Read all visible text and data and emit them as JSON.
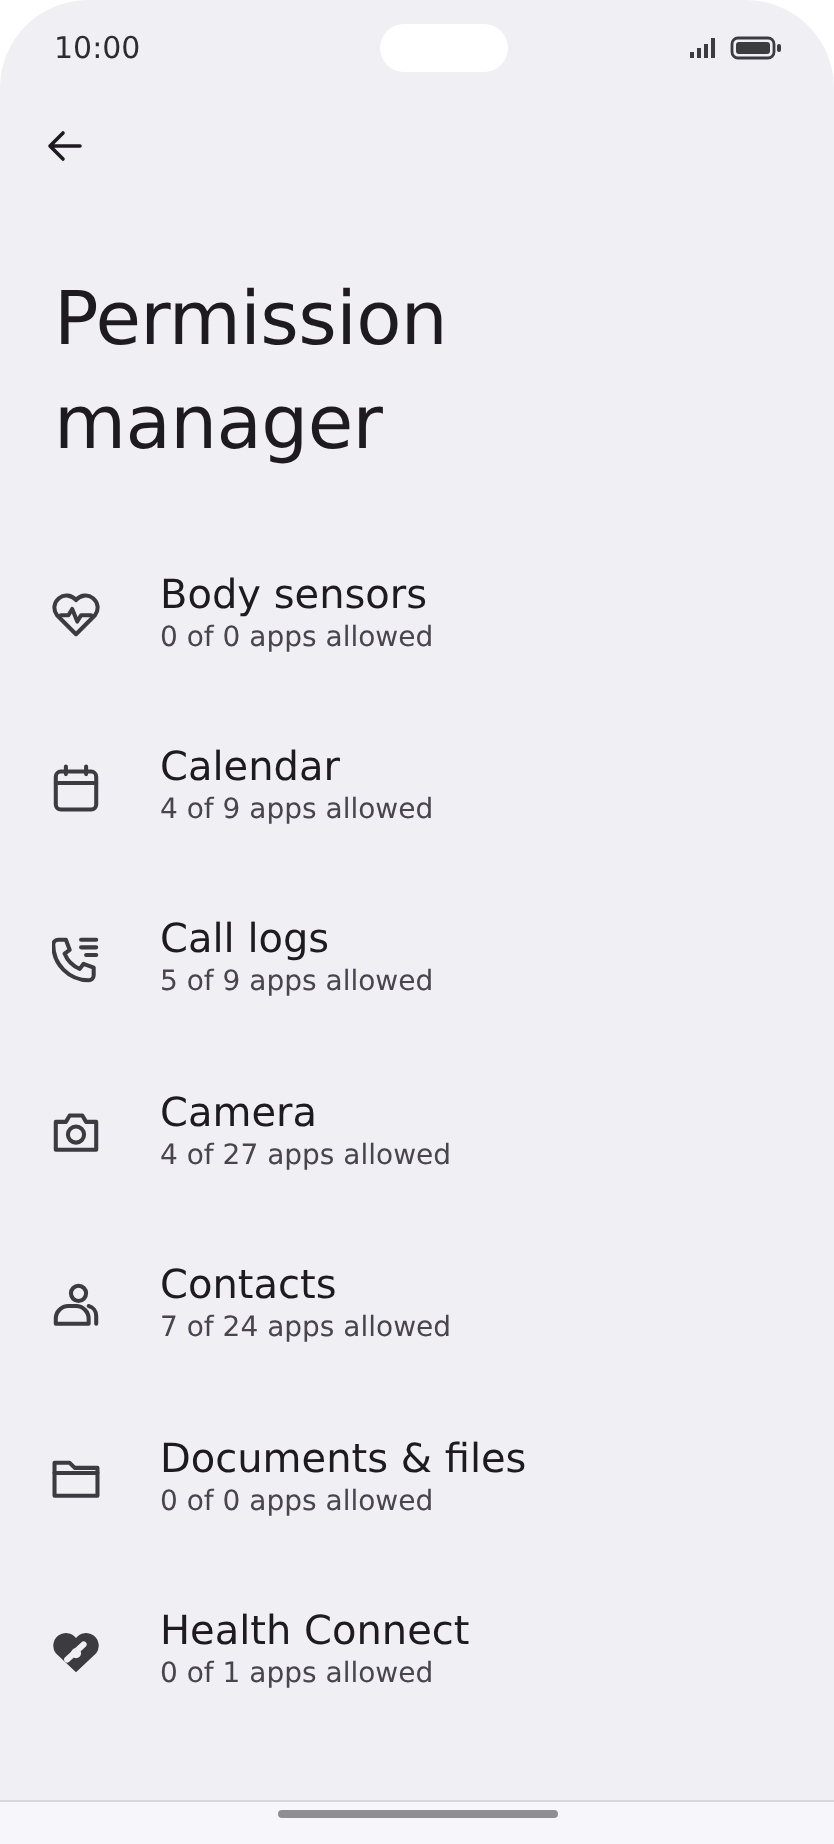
{
  "status_bar": {
    "time": "10:00"
  },
  "title": "Permission manager",
  "permissions": [
    {
      "name": "Body sensors",
      "summary": "0 of 0 apps allowed"
    },
    {
      "name": "Calendar",
      "summary": "4 of 9 apps allowed"
    },
    {
      "name": "Call logs",
      "summary": "5 of 9 apps allowed"
    },
    {
      "name": "Camera",
      "summary": "4 of 27 apps allowed"
    },
    {
      "name": "Contacts",
      "summary": "7 of 24 apps allowed"
    },
    {
      "name": "Documents & files",
      "summary": "0 of 0 apps allowed"
    },
    {
      "name": "Health Connect",
      "summary": "0 of 1 apps allowed"
    }
  ]
}
